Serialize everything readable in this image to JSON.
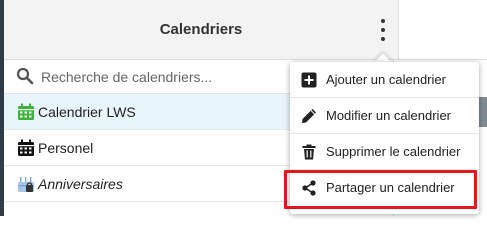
{
  "header": {
    "title": "Calendriers"
  },
  "search": {
    "placeholder": "Recherche de calendriers..."
  },
  "calendars": [
    {
      "label": "Calendrier LWS",
      "icon": "calendar-icon",
      "color": "#3cb43c",
      "selected": true
    },
    {
      "label": "Personel",
      "icon": "calendar-icon",
      "color": "#111111",
      "selected": false
    },
    {
      "label": "Anniversaires",
      "icon": "birthday-cake-icon",
      "color": "#7aa8d6",
      "selected": false
    }
  ],
  "menu": {
    "items": [
      {
        "label": "Ajouter un calendrier",
        "icon": "plus-square-icon"
      },
      {
        "label": "Modifier un calendrier",
        "icon": "pencil-icon"
      },
      {
        "label": "Supprimer le calendrier",
        "icon": "trash-icon"
      },
      {
        "label": "Partager un calendrier",
        "icon": "share-icon"
      }
    ]
  },
  "colors": {
    "accent_selected": "#e8f5fb",
    "highlight_border": "#e0191e",
    "calendar_green": "#3cb43c"
  }
}
